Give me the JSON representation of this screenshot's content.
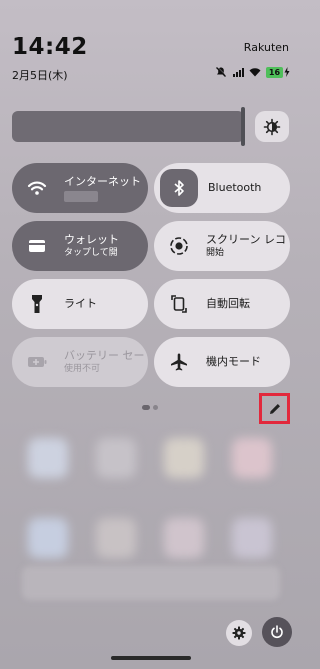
{
  "status_bar": {
    "time": "14:42",
    "date": "2月5日(木)",
    "carrier": "Rakuten",
    "battery_level": "16",
    "icons": [
      "mute-icon",
      "signal-icon",
      "wifi-icon",
      "battery-icon",
      "charging-icon"
    ]
  },
  "brightness": {
    "level_fraction": 0.94
  },
  "tiles": {
    "internet": {
      "label": "インターネット",
      "icon": "wifi-icon",
      "active": true
    },
    "bluetooth": {
      "label": "Bluetooth",
      "icon": "bluetooth-icon",
      "active": false
    },
    "wallet": {
      "label": "ウォレット",
      "sub": "タップして開",
      "icon": "wallet-icon",
      "active": true
    },
    "screen_record": {
      "label": "スクリーン レコ",
      "sub": "開始",
      "icon": "screen-record-icon",
      "active": false
    },
    "flashlight": {
      "label": "ライト",
      "icon": "flashlight-icon",
      "active": false
    },
    "auto_rotate": {
      "label": "自動回転",
      "icon": "rotate-icon",
      "active": false
    },
    "battery_saver": {
      "label": "バッテリー セー",
      "sub": "使用不可",
      "icon": "battery-saver-icon",
      "active": false
    },
    "airplane": {
      "label": "機内モード",
      "icon": "airplane-icon",
      "active": false
    }
  },
  "pager": {
    "pages": 2,
    "current": 1
  },
  "actions": {
    "edit": "pencil-icon",
    "settings": "gear-icon",
    "power": "power-icon"
  },
  "colors": {
    "active_tile": "#6c6870",
    "inactive_tile": "#e6e2e7",
    "highlight": "#e2283c"
  }
}
